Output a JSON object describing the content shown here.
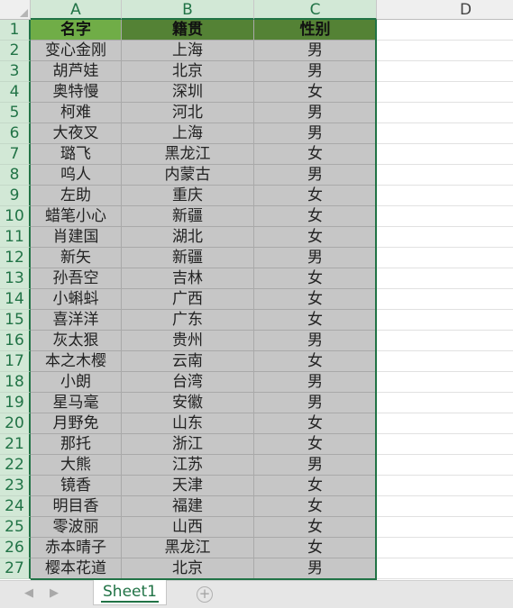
{
  "columns": [
    "A",
    "B",
    "C",
    "D"
  ],
  "header_row": {
    "number": "1",
    "name": "名字",
    "origin": "籍贯",
    "gender": "性别"
  },
  "rows": [
    {
      "number": "2",
      "name": "变心金刚",
      "origin": "上海",
      "gender": "男"
    },
    {
      "number": "3",
      "name": "胡芦娃",
      "origin": "北京",
      "gender": "男"
    },
    {
      "number": "4",
      "name": "奥特慢",
      "origin": "深圳",
      "gender": "女"
    },
    {
      "number": "5",
      "name": "柯难",
      "origin": "河北",
      "gender": "男"
    },
    {
      "number": "6",
      "name": "大夜叉",
      "origin": "上海",
      "gender": "男"
    },
    {
      "number": "7",
      "name": "璐飞",
      "origin": "黑龙江",
      "gender": "女"
    },
    {
      "number": "8",
      "name": "呜人",
      "origin": "内蒙古",
      "gender": "男"
    },
    {
      "number": "9",
      "name": "左助",
      "origin": "重庆",
      "gender": "女"
    },
    {
      "number": "10",
      "name": "蜡笔小心",
      "origin": "新疆",
      "gender": "女"
    },
    {
      "number": "11",
      "name": "肖建国",
      "origin": "湖北",
      "gender": "女"
    },
    {
      "number": "12",
      "name": "新矢",
      "origin": "新疆",
      "gender": "男"
    },
    {
      "number": "13",
      "name": "孙吾空",
      "origin": "吉林",
      "gender": "女"
    },
    {
      "number": "14",
      "name": "小蝌蚪",
      "origin": "广西",
      "gender": "女"
    },
    {
      "number": "15",
      "name": "喜洋洋",
      "origin": "广东",
      "gender": "女"
    },
    {
      "number": "16",
      "name": "灰太狠",
      "origin": "贵州",
      "gender": "男"
    },
    {
      "number": "17",
      "name": "本之木樱",
      "origin": "云南",
      "gender": "女"
    },
    {
      "number": "18",
      "name": "小朗",
      "origin": "台湾",
      "gender": "男"
    },
    {
      "number": "19",
      "name": "星马毫",
      "origin": "安徽",
      "gender": "男"
    },
    {
      "number": "20",
      "name": "月野免",
      "origin": "山东",
      "gender": "女"
    },
    {
      "number": "21",
      "name": "那托",
      "origin": "浙江",
      "gender": "女"
    },
    {
      "number": "22",
      "name": "大熊",
      "origin": "江苏",
      "gender": "男"
    },
    {
      "number": "23",
      "name": "镜香",
      "origin": "天津",
      "gender": "女"
    },
    {
      "number": "24",
      "name": "明目香",
      "origin": "福建",
      "gender": "女"
    },
    {
      "number": "25",
      "name": "零波丽",
      "origin": "山西",
      "gender": "女"
    },
    {
      "number": "26",
      "name": "赤本晴子",
      "origin": "黑龙江",
      "gender": "女"
    },
    {
      "number": "27",
      "name": "樱本花道",
      "origin": "北京",
      "gender": "男"
    }
  ],
  "sheet_tabs": [
    {
      "label": "Sheet1",
      "active": true
    }
  ],
  "icons": {
    "prev": "chevron-left-icon",
    "next": "chevron-right-icon",
    "add": "plus-circle-icon"
  },
  "colors": {
    "accent": "#217346",
    "header_fill": "#548235",
    "header_fill_a": "#70ad47",
    "selection_fill": "#c6c6c6"
  }
}
